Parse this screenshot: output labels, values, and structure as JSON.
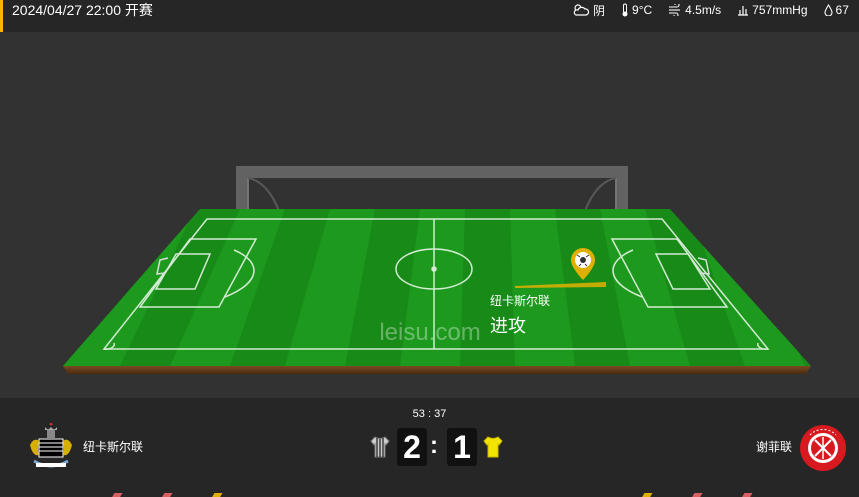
{
  "header": {
    "match_time": "2024/04/27 22:00 开赛",
    "weather": {
      "condition_icon": "cloudy-icon",
      "condition": "阴",
      "temperature_icon": "thermometer-icon",
      "temperature": "9°C",
      "wind_icon": "wind-icon",
      "wind": "4.5m/s",
      "pressure_icon": "pressure-icon",
      "pressure": "757mmHg",
      "humidity_icon": "humidity-icon",
      "humidity": "67"
    }
  },
  "pitch": {
    "watermark": "leisu.com",
    "event": {
      "team": "纽卡斯尔联",
      "type": "进攻",
      "icon": "ball-pin-icon"
    }
  },
  "scoreboard": {
    "clock": "53 : 37",
    "home": {
      "name": "纽卡斯尔联",
      "score": "2",
      "logo_icon": "newcastle-crest-icon",
      "kit_icon": "striped-shirt-icon"
    },
    "away": {
      "name": "谢菲联",
      "score": "1",
      "logo_icon": "sheffield-crest-icon",
      "kit_icon": "yellow-shirt-icon"
    },
    "separator": ":"
  },
  "colors": {
    "accent": "#f5b700",
    "pitch_green": "#1a8f1a",
    "sheffield_red": "#d71920",
    "event_gold": "#e0b000"
  }
}
